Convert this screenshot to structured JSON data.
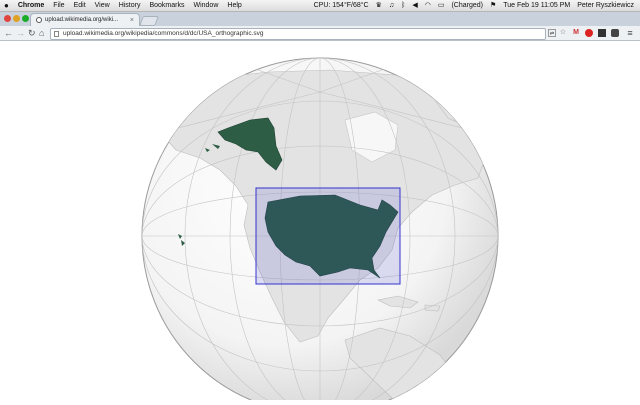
{
  "menubar": {
    "apple": "",
    "app_name": "Chrome",
    "items": [
      "File",
      "Edit",
      "View",
      "History",
      "Bookmarks",
      "Window",
      "Help"
    ],
    "cpu_status": "CPU: 154°F/68°C",
    "battery_label": "(Charged)",
    "clock": "Tue Feb 19  11:05 PM",
    "user": "Peter Ryszkiewicz"
  },
  "tab": {
    "title": "upload.wikimedia.org/wiki...",
    "close": "×"
  },
  "toolbar": {
    "back": "←",
    "forward": "→",
    "reload": "↻",
    "home": "⌂",
    "url": "upload.wikimedia.org/wikipedia/commons/d/dc/USA_orthographic.svg",
    "star": "☆",
    "menu": "≡"
  },
  "map": {
    "highlight_color": "#2d5e45",
    "land_color": "#e6e6e6",
    "ocean_color": "#f7f7f7",
    "box_color": "#3333cc"
  }
}
